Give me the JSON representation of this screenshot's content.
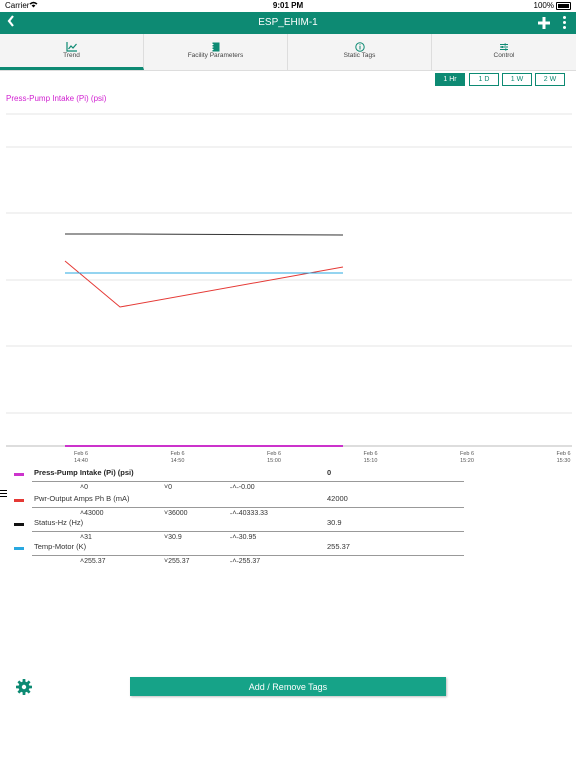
{
  "status_bar": {
    "carrier": "Carrier",
    "time": "9:01 PM",
    "battery": "100%"
  },
  "header": {
    "title": "ESP_EHIM-1",
    "back_icon": "chevron-left-icon",
    "add_icon": "plus-icon",
    "menu_icon": "kebab-icon",
    "color": "#0d8a73"
  },
  "tabs": [
    {
      "label": "Trend",
      "icon": "line-chart-icon",
      "active": true
    },
    {
      "label": "Facility Parameters",
      "icon": "notebook-icon",
      "active": false
    },
    {
      "label": "Static Tags",
      "icon": "info-icon",
      "active": false
    },
    {
      "label": "Control",
      "icon": "sliders-icon",
      "active": false
    }
  ],
  "time_ranges": {
    "options": [
      "1 Hr",
      "1 D",
      "1 W",
      "2 W"
    ],
    "selected": "1 Hr"
  },
  "chart_data": {
    "type": "line",
    "title": "Press-Pump Intake (Pi) (psi)",
    "x": [
      "Feb 6 14:40",
      "Feb 6 14:46",
      "Feb 6 15:10"
    ],
    "x_ticks": [
      {
        "date": "Feb 6",
        "time": "14:40"
      },
      {
        "date": "Feb 6",
        "time": "14:50"
      },
      {
        "date": "Feb 6",
        "time": "15:00"
      },
      {
        "date": "Feb 6",
        "time": "15:10"
      },
      {
        "date": "Feb 6",
        "time": "15:20"
      },
      {
        "date": "Feb 6",
        "time": "15:30"
      }
    ],
    "grid": true,
    "series": [
      {
        "name": "Press-Pump Intake (Pi) (psi)",
        "color": "#cc33cc",
        "values": [
          0,
          0,
          0
        ]
      },
      {
        "name": "Pwr-Output Amps Ph B (mA)",
        "color": "#e53935",
        "values": [
          40000,
          36000,
          43000
        ]
      },
      {
        "name": "Status-Hz (Hz)",
        "color": "#333333",
        "values": [
          31,
          31,
          30.9
        ]
      },
      {
        "name": "Temp-Motor (K)",
        "color": "#29a8e0",
        "values": [
          255.37,
          255.37,
          255.37
        ]
      }
    ]
  },
  "legend": [
    {
      "name": "Press-Pump Intake (Pi) (psi)",
      "value": "0",
      "max": "0",
      "min": "0",
      "avg": "-0.00",
      "color": "#cc33cc",
      "bold": true
    },
    {
      "name": "Pwr-Output Amps Ph B (mA)",
      "value": "42000",
      "max": "43000",
      "min": "36000",
      "avg": "40333.33",
      "color": "#e53935",
      "bold": false
    },
    {
      "name": "Status-Hz (Hz)",
      "value": "30.9",
      "max": "31",
      "min": "30.9",
      "avg": "30.95",
      "color": "#111111",
      "bold": false
    },
    {
      "name": "Temp-Motor (K)",
      "value": "255.37",
      "max": "255.37",
      "min": "255.37",
      "avg": "255.37",
      "color": "#29a8e0",
      "bold": false
    }
  ],
  "footer": {
    "add_remove_label": "Add / Remove Tags",
    "settings_icon": "gear-icon",
    "button_color": "#16a388"
  }
}
